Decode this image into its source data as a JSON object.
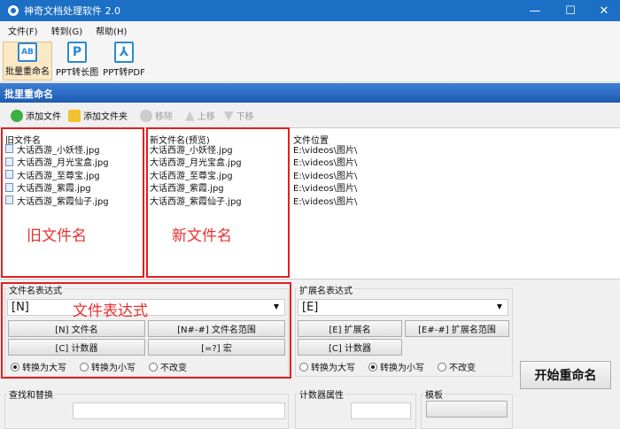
{
  "window": {
    "title": "神奇文档处理软件 2.0",
    "minimize": "—",
    "maximize": "☐",
    "close": "✕"
  },
  "menu": [
    "文件(F)",
    "转到(G)",
    "帮助(H)"
  ],
  "toolbar": [
    {
      "label": "批量重命名",
      "icon": "AB"
    },
    {
      "label": "PPT转长图",
      "icon": "P"
    },
    {
      "label": "PPT转PDF",
      "icon": "⅄"
    }
  ],
  "section_title": "批里重命名",
  "actions": {
    "add_file": "添加文件",
    "add_folder": "添加文件夹",
    "remove": "移除",
    "up": "上移",
    "down": "下移"
  },
  "columns": {
    "old": "旧文件名",
    "new": "新文件名(预览)",
    "location": "文件位置"
  },
  "rows": [
    {
      "old": "大话西游_小妖怪.jpg",
      "new": "大话西游_小妖怪.jpg",
      "location": "E:\\videos\\图片\\"
    },
    {
      "old": "大话西游_月光宝盒.jpg",
      "new": "大话西游_月光宝盒.jpg",
      "location": "E:\\videos\\图片\\"
    },
    {
      "old": "大话西游_至尊宝.jpg",
      "new": "大话西游_至尊宝.jpg",
      "location": "E:\\videos\\图片\\"
    },
    {
      "old": "大话西游_紫霞.jpg",
      "new": "大话西游_紫霞.jpg",
      "location": "E:\\videos\\图片\\"
    },
    {
      "old": "大话西游_紫霞仙子.jpg",
      "new": "大话西游_紫霞仙子.jpg",
      "location": "E:\\videos\\图片\\"
    }
  ],
  "annotations": {
    "old": "旧文件名",
    "new": "新文件名",
    "expr": "文件表达式"
  },
  "name_expr": {
    "label": "文件名表达式",
    "value": "[N]",
    "btn_name": "[N] 文件名",
    "btn_range": "[N#-#] 文件名范围",
    "btn_counter": "[C] 计数器",
    "btn_macro": "[=?] 宏",
    "upper": "转换为大写",
    "lower": "转换为小写",
    "keep": "不改变"
  },
  "ext_expr": {
    "label": "扩展名表达式",
    "value": "[E]",
    "btn_ext": "[E] 扩展名",
    "btn_range": "[E#-#] 扩展名范围",
    "btn_counter": "[C] 计数器",
    "upper": "转换为大写",
    "lower": "转换为小写",
    "keep": "不改变"
  },
  "start_button": "开始重命名",
  "find_replace": {
    "label": "查找和替换"
  },
  "counter": {
    "label": "计数器属性"
  },
  "template": {
    "label": "模板"
  }
}
